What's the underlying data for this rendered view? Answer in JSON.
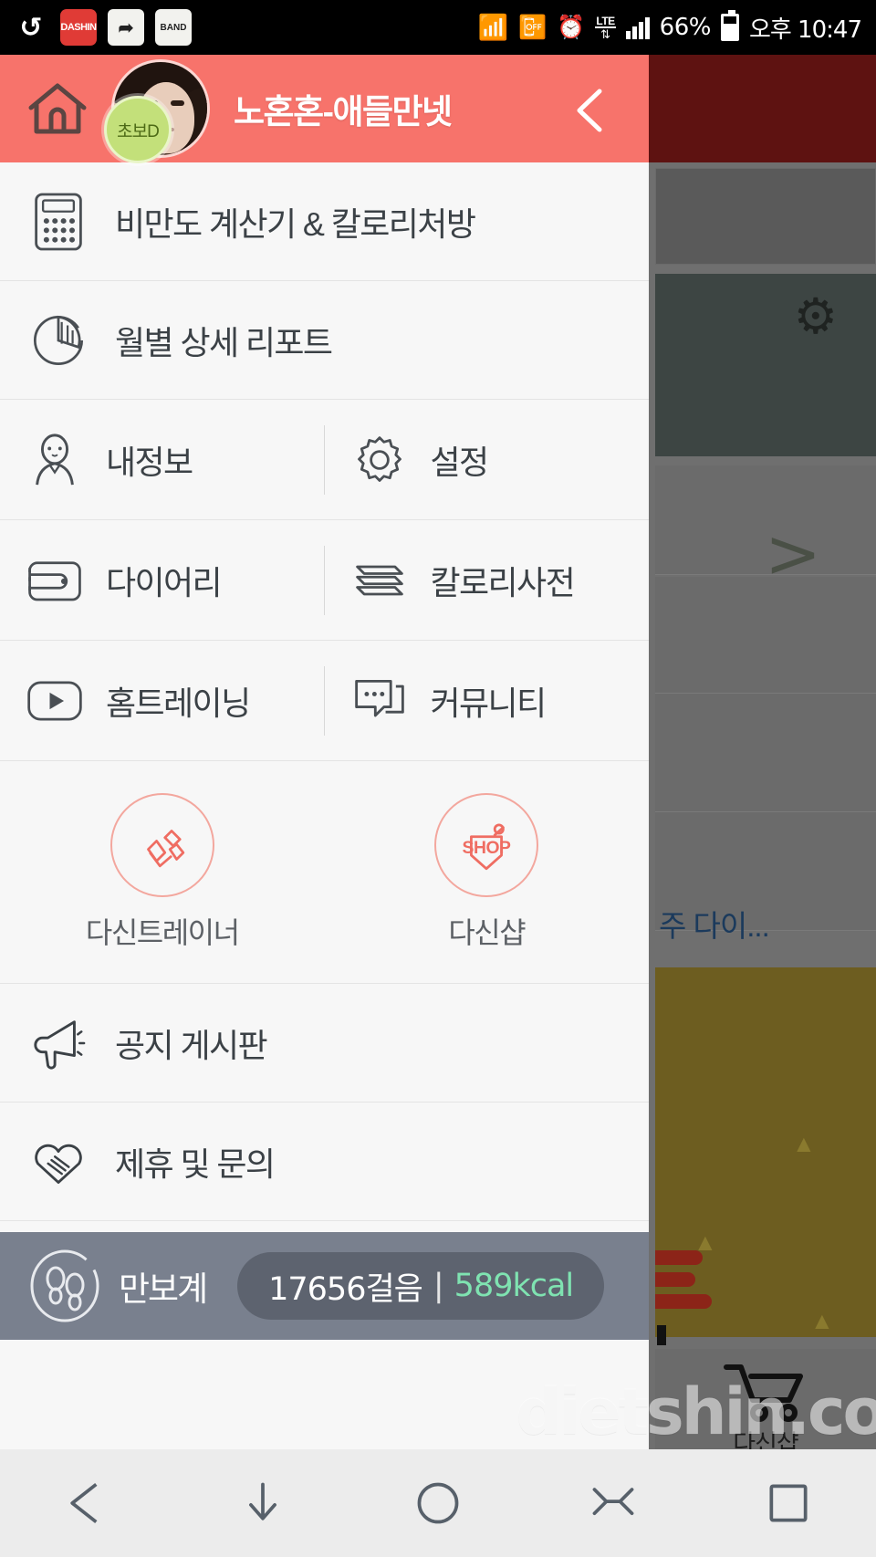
{
  "statusbar": {
    "app_icons": [
      "uplus-icon",
      "dashin-icon",
      "kakao-icon",
      "band-icon"
    ],
    "bluetooth": "bluetooth-icon",
    "vibrate": "vibrate-icon",
    "alarm": "alarm-icon",
    "network_label": "LTE",
    "signal": "signal-bars-icon",
    "battery_percent": "66%",
    "time": "오후 10:47"
  },
  "drawer": {
    "header": {
      "home_icon": "home-icon",
      "username": "노혼혼-애들만넷",
      "level_badge": "초보D",
      "back_icon": "chevron-left-icon",
      "bg_color": "#f7736b"
    },
    "full_rows": [
      {
        "icon": "calculator-icon",
        "label": "비만도 계산기 & 칼로리처방"
      },
      {
        "icon": "pie-chart-icon",
        "label": "월별 상세 리포트"
      }
    ],
    "split_rows": [
      {
        "left": {
          "icon": "user-icon",
          "label": "내정보"
        },
        "right": {
          "icon": "gear-icon",
          "label": "설정"
        }
      },
      {
        "left": {
          "icon": "wallet-icon",
          "label": "다이어리"
        },
        "right": {
          "icon": "book-icon",
          "label": "칼로리사전"
        }
      },
      {
        "left": {
          "icon": "play-icon",
          "label": "홈트레이닝"
        },
        "right": {
          "icon": "chat-icon",
          "label": "커뮤니티"
        }
      }
    ],
    "promos": [
      {
        "icon": "dumbbell-icon",
        "label": "다신트레이너"
      },
      {
        "icon": "shop-tag-icon",
        "label": "다신샵",
        "badge_text": "SHOP"
      }
    ],
    "bottom_rows": [
      {
        "icon": "megaphone-icon",
        "label": "공지 게시판"
      },
      {
        "icon": "handshake-heart-icon",
        "label": "제휴 및 문의"
      }
    ],
    "pedometer": {
      "icon": "footprints-icon",
      "label": "만보계",
      "steps": "17656걸음",
      "separator": "|",
      "calories": "589kcal",
      "calories_color": "#7fe3b1"
    }
  },
  "background_app": {
    "gear_icon": "gear-icon",
    "chevron_icon": "chevron-right-icon",
    "truncated_text": "주 다이...",
    "tab": {
      "icon": "cart-icon",
      "label": "다신샵"
    }
  },
  "watermark": "dietshin.com",
  "navbar": {
    "items": [
      {
        "icon": "back-triangle-icon"
      },
      {
        "icon": "download-arrow-icon"
      },
      {
        "icon": "home-circle-icon"
      },
      {
        "icon": "hide-keyboard-icon"
      },
      {
        "icon": "recents-square-icon"
      }
    ]
  }
}
